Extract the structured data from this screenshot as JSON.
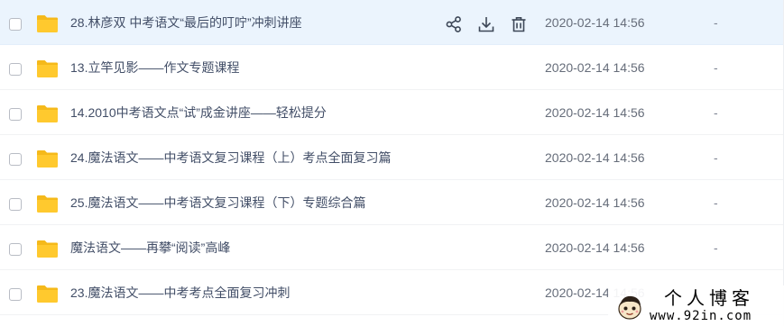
{
  "colors": {
    "folder": "#ffc92e",
    "folder_tab": "#f5b91a",
    "hover_row": "#ebf4fd",
    "text": "#424e67",
    "icon": "#3d4757"
  },
  "files": [
    {
      "name": "28.林彦双 中考语文“最后的叮咛”冲刺讲座",
      "date": "2020-02-14 14:56",
      "size": "-",
      "icon": "folder-icon"
    },
    {
      "name": "13.立竿见影——作文专题课程",
      "date": "2020-02-14 14:56",
      "size": "-",
      "icon": "folder-icon"
    },
    {
      "name": "14.2010中考语文点“试”成金讲座——轻松提分",
      "date": "2020-02-14 14:56",
      "size": "-",
      "icon": "folder-icon"
    },
    {
      "name": "24.魔法语文——中考语文复习课程（上）考点全面复习篇",
      "date": "2020-02-14 14:56",
      "size": "-",
      "icon": "folder-icon"
    },
    {
      "name": "25.魔法语文——中考语文复习课程（下）专题综合篇",
      "date": "2020-02-14 14:56",
      "size": "-",
      "icon": "folder-icon"
    },
    {
      "name": "魔法语文——再攀“阅读”高峰",
      "date": "2020-02-14 14:56",
      "size": "-",
      "icon": "folder-icon"
    },
    {
      "name": "23.魔法语文——中考考点全面复习冲刺",
      "date": "2020-02-14 14:56",
      "size": "-",
      "icon": "folder-icon"
    }
  ],
  "row_actions": [
    {
      "icon": "share-icon"
    },
    {
      "icon": "download-icon"
    },
    {
      "icon": "delete-icon"
    }
  ],
  "watermark": {
    "title": "个人博客",
    "url": "www.92in.com"
  }
}
